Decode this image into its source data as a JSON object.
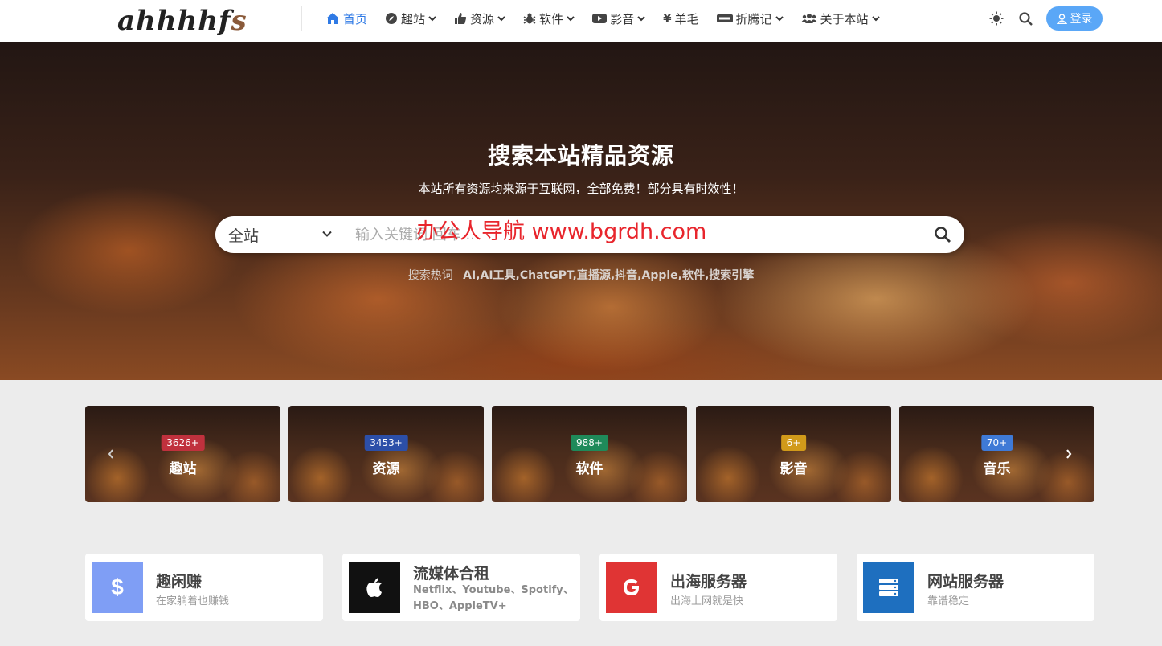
{
  "header": {
    "logo_text": "ahhhhf",
    "logo_tail": "s",
    "nav": [
      {
        "label": "首页",
        "icon": "home-icon",
        "active": true,
        "dropdown": false
      },
      {
        "label": "趣站",
        "icon": "compass-icon",
        "active": false,
        "dropdown": true
      },
      {
        "label": "资源",
        "icon": "thumbs-up-icon",
        "active": false,
        "dropdown": true
      },
      {
        "label": "软件",
        "icon": "bug-icon",
        "active": false,
        "dropdown": true
      },
      {
        "label": "影音",
        "icon": "youtube-icon",
        "active": false,
        "dropdown": true
      },
      {
        "label": "羊毛",
        "icon": "yen-icon",
        "active": false,
        "dropdown": false
      },
      {
        "label": "折腾记",
        "icon": "keyboard-icon",
        "active": false,
        "dropdown": true
      },
      {
        "label": "关于本站",
        "icon": "users-icon",
        "active": false,
        "dropdown": true
      }
    ],
    "login_label": "登录"
  },
  "hero": {
    "title": "搜索本站精品资源",
    "subtitle": "本站所有资源均来源于互联网，全部免费！部分具有时效性！",
    "search_scope": "全站",
    "search_placeholder": "输入关键词 回车...",
    "watermark": "办公人导航  www.bgrdh.com",
    "hot_label": "搜索热词",
    "hot_words": "AI,AI工具,ChatGPT,直播源,抖音,Apple,软件,搜索引擎"
  },
  "categories": [
    {
      "name": "趣站",
      "count": "3626+",
      "badge_color": "#c0313d"
    },
    {
      "name": "资源",
      "count": "3453+",
      "badge_color": "#2c4fa8"
    },
    {
      "name": "软件",
      "count": "988+",
      "badge_color": "#1f8a5a"
    },
    {
      "name": "影音",
      "count": "6+",
      "badge_color": "#d19a1a"
    },
    {
      "name": "音乐",
      "count": "70+",
      "badge_color": "#3f7ad6"
    }
  ],
  "features": [
    {
      "title": "趣闲赚",
      "desc": "在家躺着也赚钱",
      "icon": "dollar-icon",
      "color": "#7f9ef5"
    },
    {
      "title": "流媒体合租",
      "desc": "Netflix、Youtube、Spotify、HBO、AppleTV+",
      "icon": "apple-icon",
      "color": "#111111"
    },
    {
      "title": "出海服务器",
      "desc": "出海上网就是快",
      "icon": "google-icon",
      "color": "#e03434"
    },
    {
      "title": "网站服务器",
      "desc": "靠谱稳定",
      "icon": "server-icon",
      "color": "#1e6fbf"
    }
  ]
}
